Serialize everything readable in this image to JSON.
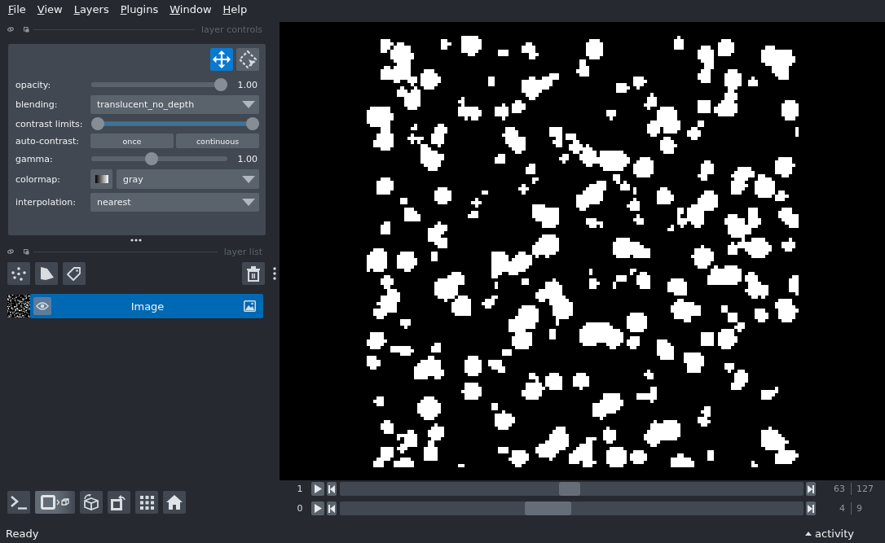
{
  "menu": [
    "File",
    "View",
    "Layers",
    "Plugins",
    "Window",
    "Help"
  ],
  "layer_controls": {
    "title": "layer controls",
    "mode_buttons": [
      {
        "kind": "pan_zoom",
        "selected": true
      },
      {
        "kind": "transform",
        "selected": false
      }
    ],
    "rows": [
      {
        "kind": "slider",
        "label": "opacity:",
        "level": 1,
        "reading": "1.00"
      },
      {
        "kind": "dropdown",
        "label": "blending:",
        "value": "translucent_no_depth"
      },
      {
        "kind": "range",
        "label": "contrast limits:",
        "handles": [
          {
            "level": 0
          },
          {
            "level": 1
          }
        ]
      },
      {
        "kind": "buttons",
        "label": "auto-contrast:",
        "buttons": [
          "once",
          "continuous"
        ]
      },
      {
        "kind": "slider",
        "label": "gamma:",
        "level": 0.44,
        "reading": "1.00"
      },
      {
        "kind": "colormap",
        "label": "colormap:",
        "value": "gray"
      },
      {
        "kind": "dropdown",
        "label": "interpolation:",
        "value": "nearest"
      }
    ]
  },
  "layer_list": {
    "title": "layer list",
    "layers": [
      {
        "name": "Image",
        "selected": true,
        "visible": true
      }
    ]
  },
  "dims": [
    {
      "axis": "1",
      "level": 0.496,
      "current": "63",
      "max": "127"
    },
    {
      "axis": "0",
      "level": 0.444,
      "current": "4",
      "max": "9"
    }
  ],
  "status_bar": {
    "message": "Ready",
    "activity": "activity"
  }
}
